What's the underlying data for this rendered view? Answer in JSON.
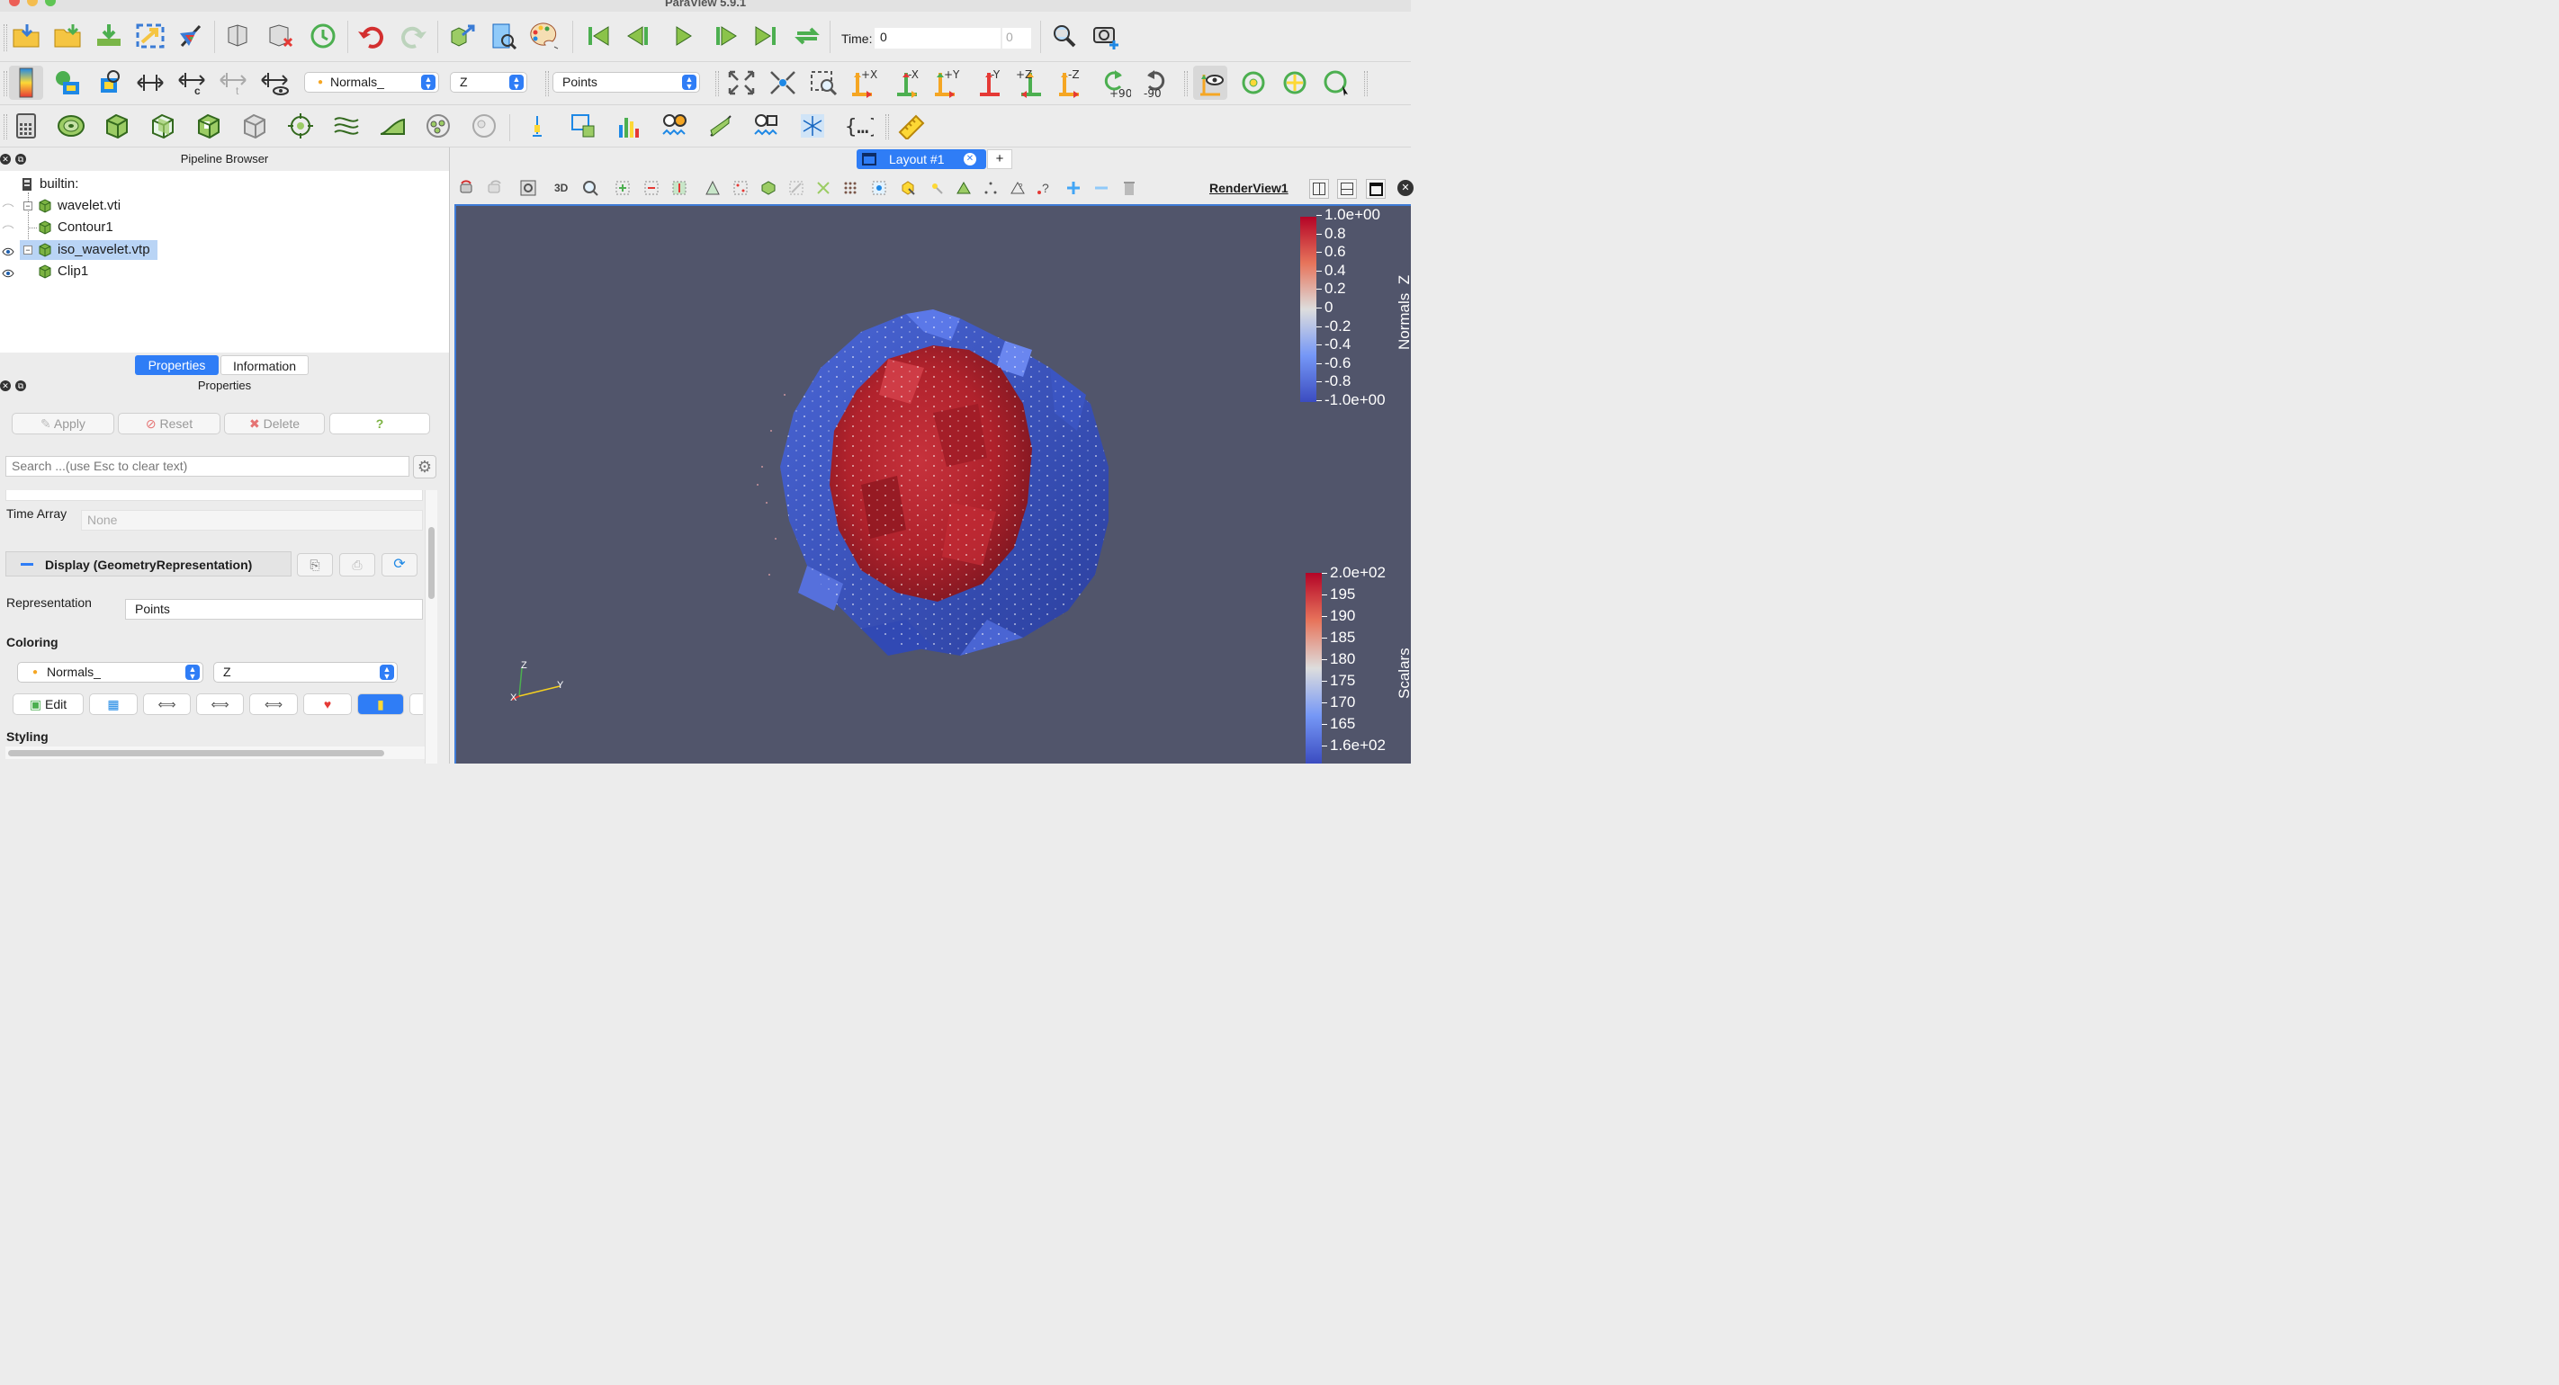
{
  "window": {
    "title": "ParaView 5.9.1"
  },
  "toolbar1": {
    "time_label": "Time:",
    "time_value": "0",
    "time_index": "0"
  },
  "toolbar2": {
    "color_array": "Normals_",
    "component": "Z",
    "representation": "Points",
    "axes_buttons": [
      "+X",
      "-X",
      "+Y",
      "-Y",
      "+Z",
      "-Z"
    ],
    "rotate_labels": [
      "+90",
      "-90"
    ]
  },
  "pipeline": {
    "title": "Pipeline Browser",
    "items": [
      {
        "label": "builtin:",
        "visible": null
      },
      {
        "label": "wavelet.vti",
        "visible": false
      },
      {
        "label": "Contour1",
        "visible": false
      },
      {
        "label": "iso_wavelet.vtp",
        "visible": true,
        "selected": true
      },
      {
        "label": "Clip1",
        "visible": true
      }
    ]
  },
  "tabs": {
    "properties": "Properties",
    "information": "Information"
  },
  "properties": {
    "title": "Properties",
    "apply": "Apply",
    "reset": "Reset",
    "delete": "Delete",
    "help": "?",
    "search_placeholder": "Search ...(use Esc to clear text)",
    "time_array_label": "Time Array",
    "time_array_value": "None",
    "display_section": "Display (GeometryRepresentation)",
    "representation_label": "Representation",
    "representation_value": "Points",
    "coloring_label": "Coloring",
    "coloring_array": "Normals_",
    "coloring_component": "Z",
    "edit_label": "Edit",
    "styling_label": "Styling"
  },
  "layout": {
    "tab_label": "Layout #1",
    "add": "+"
  },
  "viewbar": {
    "three_d": "3D",
    "view_name": "RenderView1"
  },
  "renderview": {
    "background": "#51556b",
    "colorbar_normals": {
      "title": "Normals_Z",
      "labels": [
        "1.0e+00",
        "0.8",
        "0.6",
        "0.4",
        "0.2",
        "0",
        "-0.2",
        "-0.4",
        "-0.6",
        "-0.8",
        "-1.0e+00"
      ]
    },
    "colorbar_scalars": {
      "title": "Scalars",
      "labels": [
        "2.0e+02",
        "195",
        "190",
        "185",
        "180",
        "175",
        "170",
        "165",
        "1.6e+02"
      ]
    },
    "axes": {
      "z": "Z",
      "x": "X",
      "y": "Y"
    }
  },
  "colors": {
    "accent": "#2f7df6",
    "red": "#b4232c",
    "blue": "#3c55c8",
    "green_icon": "#4caf50"
  }
}
